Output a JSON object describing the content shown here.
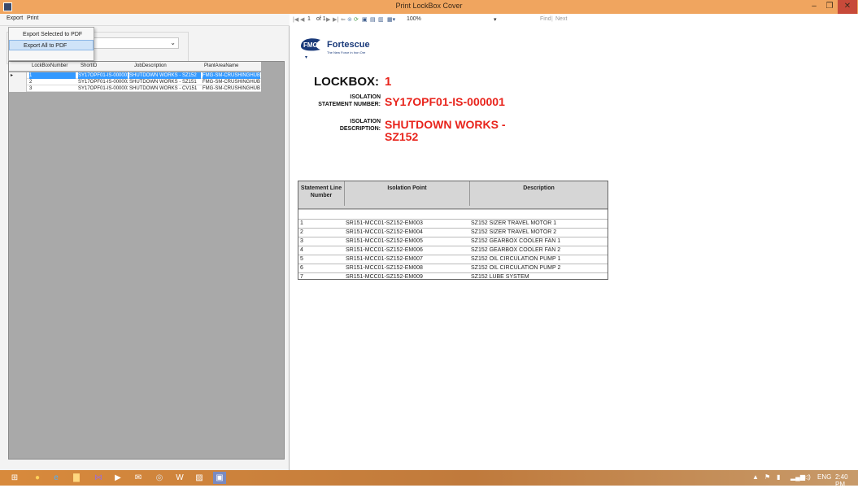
{
  "window": {
    "title": "Print LockBox Cover",
    "min": "–",
    "max": "❐",
    "close": "✕"
  },
  "menu": {
    "export": "Export",
    "print": "Print",
    "items": [
      "Export Selected to PDF",
      "Export All to PDF"
    ]
  },
  "grid": {
    "columns": [
      "LockBoxNumber",
      "ShortID",
      "JobDescription",
      "PlantAreaName"
    ],
    "rows": [
      {
        "indicator": "▸",
        "cells": [
          "1",
          "SY17OPF01-IS-000001",
          "SHUTDOWN WORKS - SZ152",
          "FMG-SM-CRUSHINGHUB"
        ]
      },
      {
        "indicator": "",
        "cells": [
          "2",
          "SY17OPF01-IS-000002",
          "SHUTDOWN WORKS - SZ151",
          "FMG-SM-CRUSHINGHUB"
        ]
      },
      {
        "indicator": "",
        "cells": [
          "3",
          "SY17OPF01-IS-000003",
          "SHUTDOWN WORKS - CV151",
          "FMG-SM-CRUSHINGHUB"
        ]
      }
    ]
  },
  "toolbar": {
    "first": "|◀",
    "prev": "◀",
    "page": "1",
    "of": "of 1",
    "next": "▶",
    "last": "▶|",
    "back": "⇐",
    "stop": "⊗",
    "refresh": "⟳",
    "print": "▣",
    "layout": "▤",
    "setup": "▥",
    "export": "▦▾",
    "zoom": "100%",
    "zoom_arrow": "▾",
    "find": "Find",
    "sep": "|",
    "next_find": "Next"
  },
  "report": {
    "logo_text": "Fortescue",
    "logo_tag": "The New Force in Iron Ore",
    "logo_mark": "FMG",
    "lockbox_label": "LOCKBOX:",
    "lockbox_value": "1",
    "iso_stmt_label_1": "ISOLATION",
    "iso_stmt_label_2": "STATEMENT NUMBER:",
    "iso_stmt_value": "SY17OPF01-IS-000001",
    "iso_desc_label_1": "ISOLATION",
    "iso_desc_label_2": "DESCRIPTION:",
    "iso_desc_value": "SHUTDOWN WORKS - SZ152",
    "table": {
      "headers": [
        "Statement Line Number",
        "Isolation Point",
        "Description"
      ],
      "rows": [
        [
          "",
          "",
          ""
        ],
        [
          "1",
          "SR151-MCC01-SZ152-EM003",
          "SZ152 SIZER TRAVEL MOTOR 1"
        ],
        [
          "2",
          "SR151-MCC01-SZ152-EM004",
          "SZ152 SIZER TRAVEL MOTOR 2"
        ],
        [
          "3",
          "SR151-MCC01-SZ152-EM005",
          "SZ152 GEARBOX COOLER FAN 1"
        ],
        [
          "4",
          "SR151-MCC01-SZ152-EM006",
          "SZ152 GEARBOX COOLER FAN 2"
        ],
        [
          "5",
          "SR151-MCC01-SZ152-EM007",
          "SZ152 OIL CIRCULATION PUMP 1"
        ],
        [
          "6",
          "SR151-MCC01-SZ152-EM008",
          "SZ152 OIL CIRCULATION PUMP 2"
        ],
        [
          "7",
          "SR151-MCC01-SZ152-EM009",
          "SZ152 LUBE SYSTEM"
        ]
      ]
    }
  },
  "taskbar": {
    "start": "⊞",
    "firefox": "●",
    "ie": "e",
    "explorer": "▇",
    "vs": "⋈",
    "ps": "▶",
    "outlook": "✉",
    "app1": "◎",
    "word": "W",
    "app2": "▨",
    "app3": "▣",
    "tray_up": "▲",
    "tray_flag": "⚑",
    "tray_net": "▮",
    "tray_sig": "▂▄▆",
    "tray_vol": "◁)",
    "lang": "ENG",
    "time": "2:40 PM"
  }
}
